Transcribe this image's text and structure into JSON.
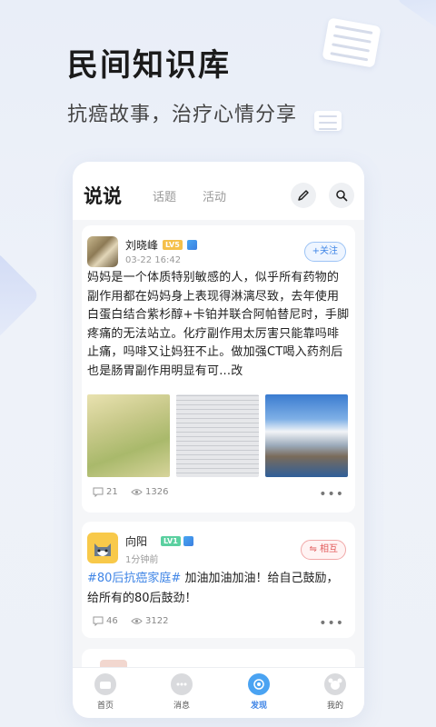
{
  "hero": {
    "title": "民间知识库",
    "subtitle": "抗癌故事，治疗心情分享"
  },
  "tabs": [
    {
      "label": "说说",
      "active": true
    },
    {
      "label": "话题",
      "active": false
    },
    {
      "label": "活动",
      "active": false
    }
  ],
  "toolbar": {
    "edit_icon": "pencil-icon",
    "search_icon": "search-icon"
  },
  "posts": [
    {
      "user": "刘晓峰",
      "level": "LV5",
      "time": "03-22 16:42",
      "action": "+关注",
      "text": "妈妈是一个体质特别敏感的人，似乎所有药物的副作用都在妈妈身上表现得淋漓尽致，去年使用白蛋白结合紫杉醇+卡铂并联合阿帕替尼时，手脚疼痛的无法站立。化疗副作用太厉害只能靠吗啡止痛，吗啡又让妈狂不止。做加强CT喝入药剂后也是肠胃副作用明显有可...改",
      "comments": "21",
      "views": "1326"
    },
    {
      "user": "向阳",
      "level": "LV1",
      "time": "1分钟前",
      "action": "⇋ 相互",
      "hashtag": "#80后抗癌家庭#",
      "text": " 加油加油加油！给自己鼓励，给所有的80后鼓劲！",
      "comments": "46",
      "views": "3122"
    }
  ],
  "nav": [
    {
      "label": "首页",
      "icon": "home-icon",
      "active": false
    },
    {
      "label": "消息",
      "icon": "message-icon",
      "active": false
    },
    {
      "label": "发现",
      "icon": "discover-icon",
      "active": true
    },
    {
      "label": "我的",
      "icon": "profile-icon",
      "active": false
    }
  ],
  "colors": {
    "accent": "#3f85e6",
    "mutual": "#e25b5b",
    "lv5": "#f5c04a",
    "lv1": "#5bd0a0"
  }
}
